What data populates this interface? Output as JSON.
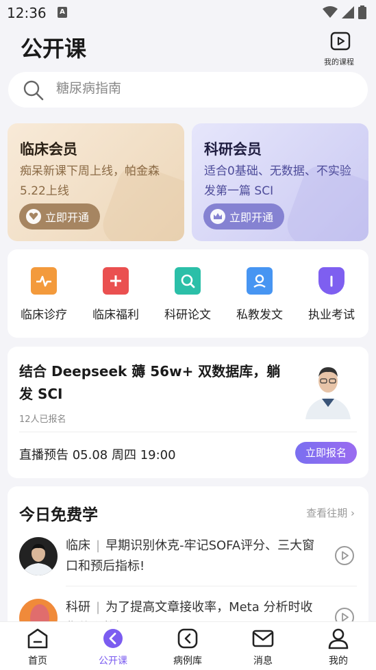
{
  "status": {
    "time": "12:36",
    "notif_letter": "A"
  },
  "header": {
    "title": "公开课",
    "my_course_label": "我的课程"
  },
  "search": {
    "placeholder": "糖尿病指南"
  },
  "members": [
    {
      "title": "临床会员",
      "desc": "痴呆新课下周上线，帕金森5.22上线",
      "button": "立即开通",
      "accent": "#a68561"
    },
    {
      "title": "科研会员",
      "desc": "适合0基础、无数据、不实验发第一篇 SCI",
      "button": "立即开通",
      "accent": "#8582d2"
    }
  ],
  "categories": [
    {
      "label": "临床诊疗",
      "icon": "pulse-icon",
      "color": "#f08a2a"
    },
    {
      "label": "临床福利",
      "icon": "plus-icon",
      "color": "#e84848"
    },
    {
      "label": "科研论文",
      "icon": "search-doc-icon",
      "color": "#24b9a5"
    },
    {
      "label": "私教发文",
      "icon": "person-card-icon",
      "color": "#3d8ff0"
    },
    {
      "label": "执业考试",
      "icon": "badge-icon",
      "color": "#7a5cf0"
    }
  ],
  "live": {
    "title": "结合 Deepseek 薅 56w+ 双数据库，躺发 SCI",
    "count": "12人已报名",
    "time": "直播预告 05.08 周四 19:00",
    "button": "立即报名"
  },
  "free": {
    "title": "今日免费学",
    "more": "查看往期",
    "items": [
      {
        "category": "临床",
        "separator": "|",
        "title": "早期识别休克-牢记SOFA评分、三大窗口和预后指标!"
      },
      {
        "category": "科研",
        "separator": "|",
        "title": "为了提高文章接收率，Meta 分析时收集什么数据?"
      }
    ]
  },
  "tabs": [
    {
      "label": "首页",
      "icon": "home-icon"
    },
    {
      "label": "公开课",
      "icon": "play-circle-icon",
      "active": true
    },
    {
      "label": "病例库",
      "icon": "case-icon"
    },
    {
      "label": "消息",
      "icon": "mail-icon"
    },
    {
      "label": "我的",
      "icon": "user-icon"
    }
  ],
  "colors": {
    "accent": "#7b5cf0",
    "background": "#f4f4f8"
  }
}
